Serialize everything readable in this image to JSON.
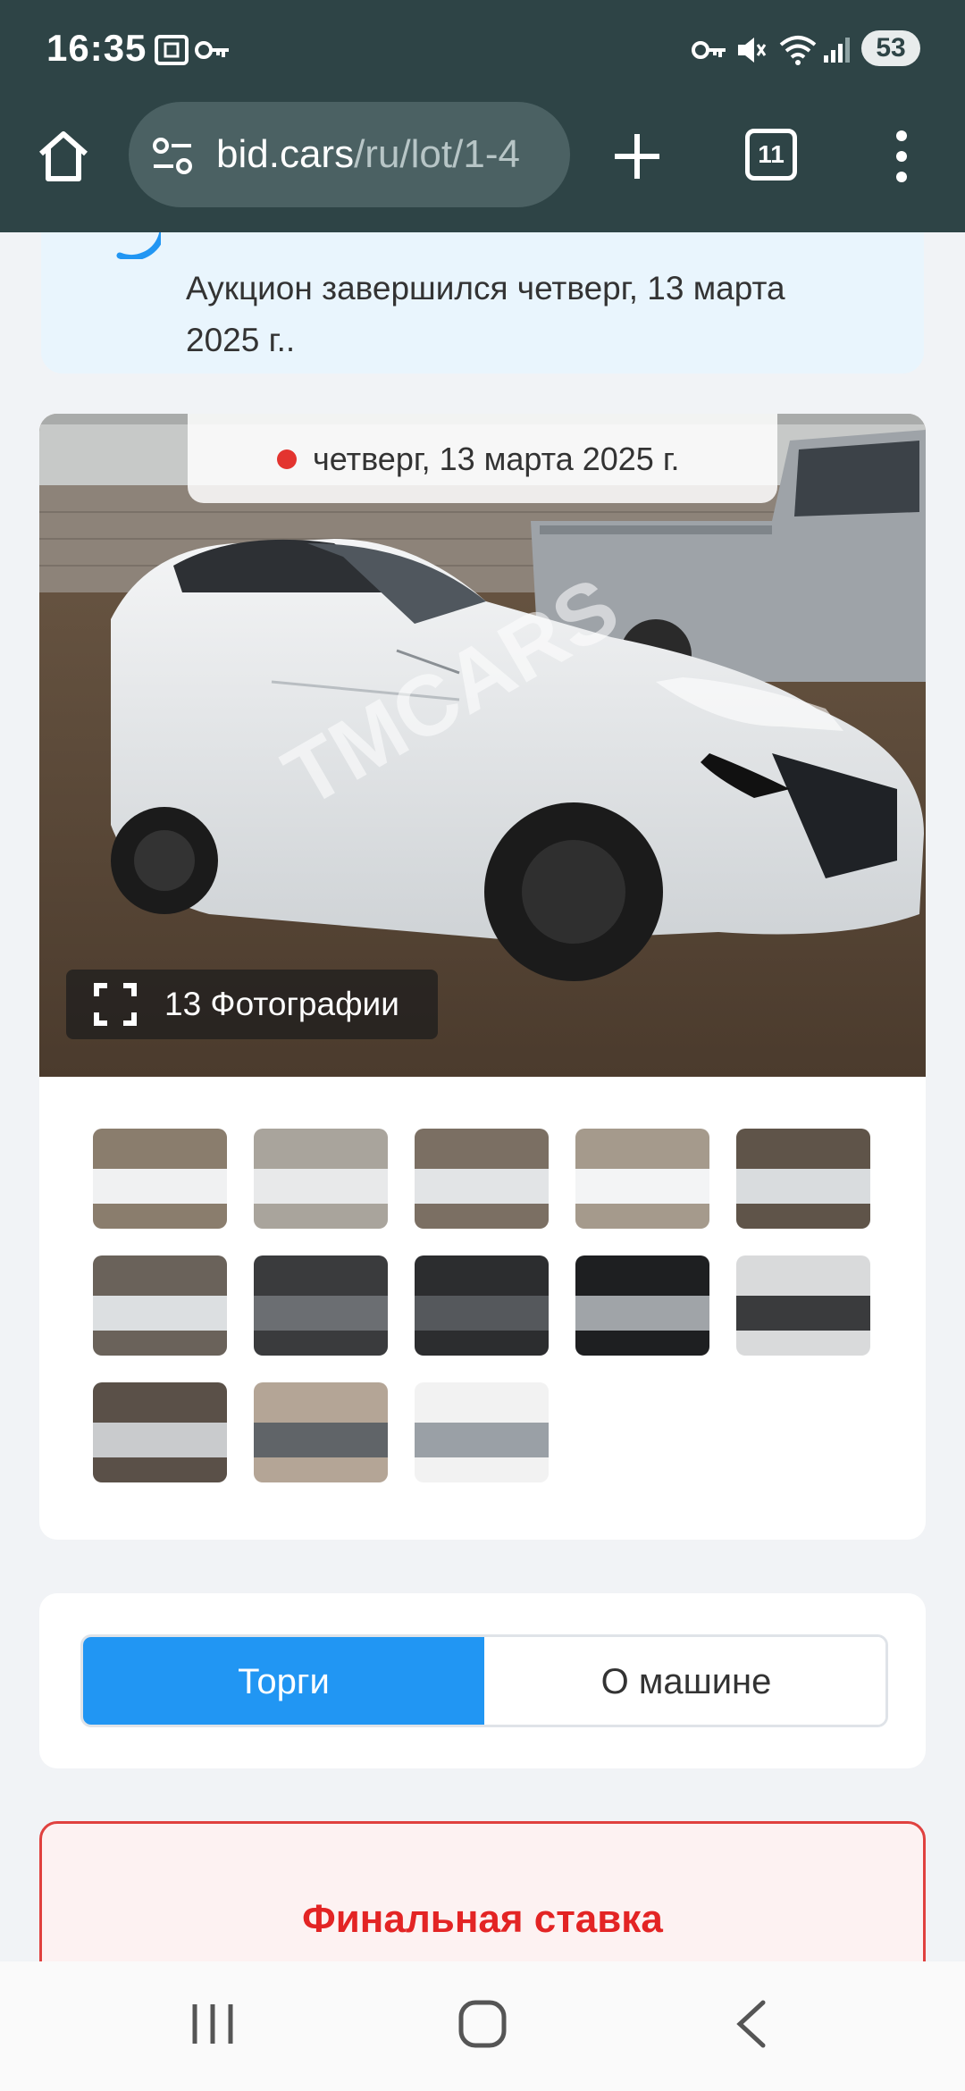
{
  "status_bar": {
    "time": "16:35",
    "battery": "53"
  },
  "browser": {
    "url_host": "bid.cars",
    "url_path": "/ru/lot/1-4",
    "tab_count": "11"
  },
  "notice": {
    "text": "Аукцион завершился четверг, 13 марта 2025 г.."
  },
  "gallery": {
    "date": "четверг, 13 марта 2025 г.",
    "photos_label": "13 Фотографии",
    "thumbnail_count": 13
  },
  "tabs": {
    "active": "Торги",
    "inactive": "О машине"
  },
  "bid": {
    "title": "Финальная ставка"
  },
  "watermark": "TMCARS",
  "colors": {
    "chrome": "#2e4446",
    "accent_blue": "#2196f3",
    "bid_red": "#e32424"
  }
}
